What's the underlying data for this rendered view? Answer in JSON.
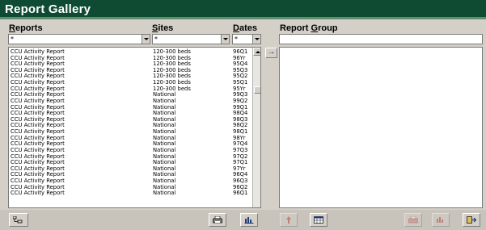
{
  "window": {
    "title": "Report Gallery"
  },
  "headers": {
    "reports": {
      "first": "R",
      "rest": "eports"
    },
    "sites": {
      "first": "S",
      "rest": "ites"
    },
    "dates": {
      "first": "D",
      "rest": "ates"
    },
    "group_pre": "Report ",
    "group_first": "G",
    "group_rest": "roup"
  },
  "filters": {
    "reports": "*",
    "sites": "*",
    "dates": "*"
  },
  "rows": [
    {
      "report": "CCU Activity Report",
      "site": "120-300 beds",
      "date": "96Q1"
    },
    {
      "report": "CCU Activity Report",
      "site": "120-300 beds",
      "date": "96Yr"
    },
    {
      "report": "CCU Activity Report",
      "site": "120-300 beds",
      "date": "95Q4"
    },
    {
      "report": "CCU Activity Report",
      "site": "120-300 beds",
      "date": "95Q3"
    },
    {
      "report": "CCU Activity Report",
      "site": "120-300 beds",
      "date": "95Q2"
    },
    {
      "report": "CCU Activity Report",
      "site": "120-300 beds",
      "date": "95Q1"
    },
    {
      "report": "CCU Activity Report",
      "site": "120-300 beds",
      "date": "95Yr"
    },
    {
      "report": "CCU Activity Report",
      "site": "National",
      "date": "99Q3"
    },
    {
      "report": "CCU Activity Report",
      "site": "National",
      "date": "99Q2"
    },
    {
      "report": "CCU Activity Report",
      "site": "National",
      "date": "99Q1"
    },
    {
      "report": "CCU Activity Report",
      "site": "National",
      "date": "98Q4"
    },
    {
      "report": "CCU Activity Report",
      "site": "National",
      "date": "98Q3"
    },
    {
      "report": "CCU Activity Report",
      "site": "National",
      "date": "98Q2"
    },
    {
      "report": "CCU Activity Report",
      "site": "National",
      "date": "98Q1"
    },
    {
      "report": "CCU Activity Report",
      "site": "National",
      "date": "98Yr"
    },
    {
      "report": "CCU Activity Report",
      "site": "National",
      "date": "97Q4"
    },
    {
      "report": "CCU Activity Report",
      "site": "National",
      "date": "97Q3"
    },
    {
      "report": "CCU Activity Report",
      "site": "National",
      "date": "97Q2"
    },
    {
      "report": "CCU Activity Report",
      "site": "National",
      "date": "97Q1"
    },
    {
      "report": "CCU Activity Report",
      "site": "National",
      "date": "97Yr"
    },
    {
      "report": "CCU Activity Report",
      "site": "National",
      "date": "96Q4"
    },
    {
      "report": "CCU Activity Report",
      "site": "National",
      "date": "96Q3"
    },
    {
      "report": "CCU Activity Report",
      "site": "National",
      "date": "96Q2"
    },
    {
      "report": "CCU Activity Report",
      "site": "National",
      "date": "96Q1"
    }
  ],
  "icons": {
    "select_arrow": "→",
    "tree": "tree-icon",
    "print": "printer-icon",
    "chart": "bar-chart-icon",
    "up": "up-arrow-icon",
    "table": "table-icon",
    "exit": "exit-door-icon"
  },
  "colors": {
    "title_bar": "#0f4a33",
    "window": "#d4d0c8"
  }
}
